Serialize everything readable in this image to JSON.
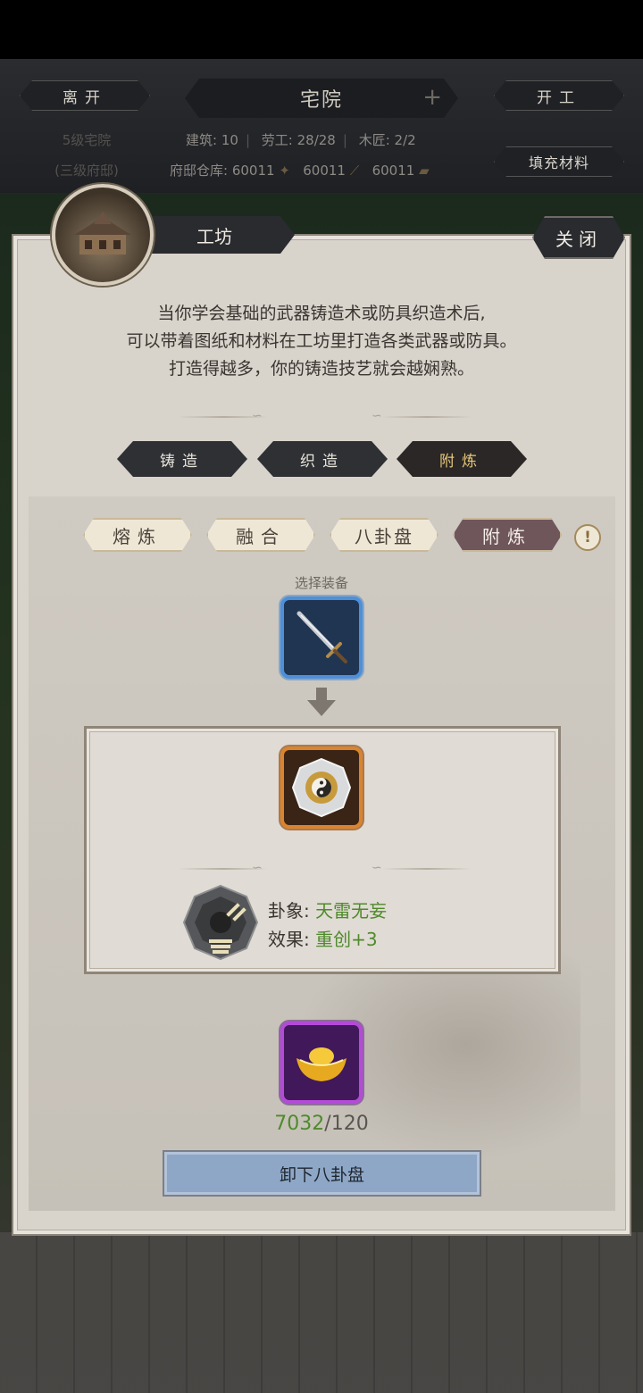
{
  "header": {
    "leave_label": "离开",
    "title": "宅院",
    "start_label": "开工",
    "fill_label": "填充材料",
    "house_level": "5级宅院",
    "house_sub": "(三级府邸)",
    "building_label": "建筑:",
    "building_value": "10",
    "labor_label": "劳工:",
    "labor_value": "28/28",
    "carpenter_label": "木匠:",
    "carpenter_value": "2/2",
    "storage_label": "府邸仓库:",
    "storage_values": [
      "60011",
      "60011",
      "60011"
    ]
  },
  "panel": {
    "title": "工坊",
    "close_label": "关闭",
    "description_lines": [
      "当你学会基础的武器铸造术或防具织造术后,",
      "可以带着图纸和材料在工坊里打造各类武器或防具。",
      "打造得越多，你的铸造技艺就会越娴熟。"
    ],
    "main_tabs": [
      {
        "label": "铸造",
        "active": false
      },
      {
        "label": "织造",
        "active": false
      },
      {
        "label": "附炼",
        "active": true
      }
    ],
    "sub_tabs": [
      {
        "label": "熔炼",
        "active": false
      },
      {
        "label": "融合",
        "active": false
      },
      {
        "label": "八卦盘",
        "active": false
      },
      {
        "label": "附炼",
        "active": true
      }
    ],
    "select_equipment_label": "选择装备",
    "trigram_label": "卦象:",
    "trigram_value": "天雷无妄",
    "effect_label": "效果:",
    "effect_value": "重创+3",
    "cost_have": "7032",
    "cost_need": "/120",
    "action_label": "卸下八卦盘"
  },
  "colors": {
    "accent_green": "#4f8a2d",
    "tab_active_gold": "#e8c77a",
    "sub_tab_active": "#6f565b",
    "action_button": "#8ea7c6"
  }
}
